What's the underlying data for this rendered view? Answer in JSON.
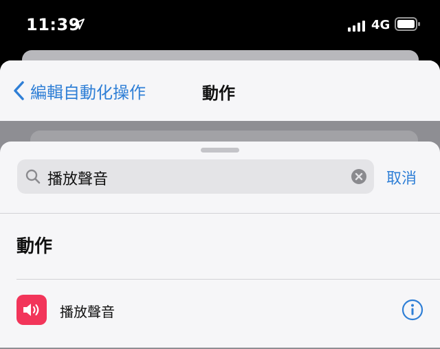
{
  "status_bar": {
    "time": "11:39",
    "network": "4G",
    "icons": [
      "location-arrow-icon",
      "signal-bars-icon",
      "battery-icon"
    ]
  },
  "nav": {
    "back_label": "編輯自動化操作",
    "title": "動作"
  },
  "search": {
    "query": "播放聲音",
    "cancel_label": "取消"
  },
  "section": {
    "header": "動作"
  },
  "results": [
    {
      "label": "播放聲音",
      "icon": "speaker-icon",
      "icon_color": "#f2355a"
    }
  ],
  "colors": {
    "accent": "#2f7fd6",
    "sheet_background": "#f6f6f8",
    "status_bar_background": "#000000"
  }
}
